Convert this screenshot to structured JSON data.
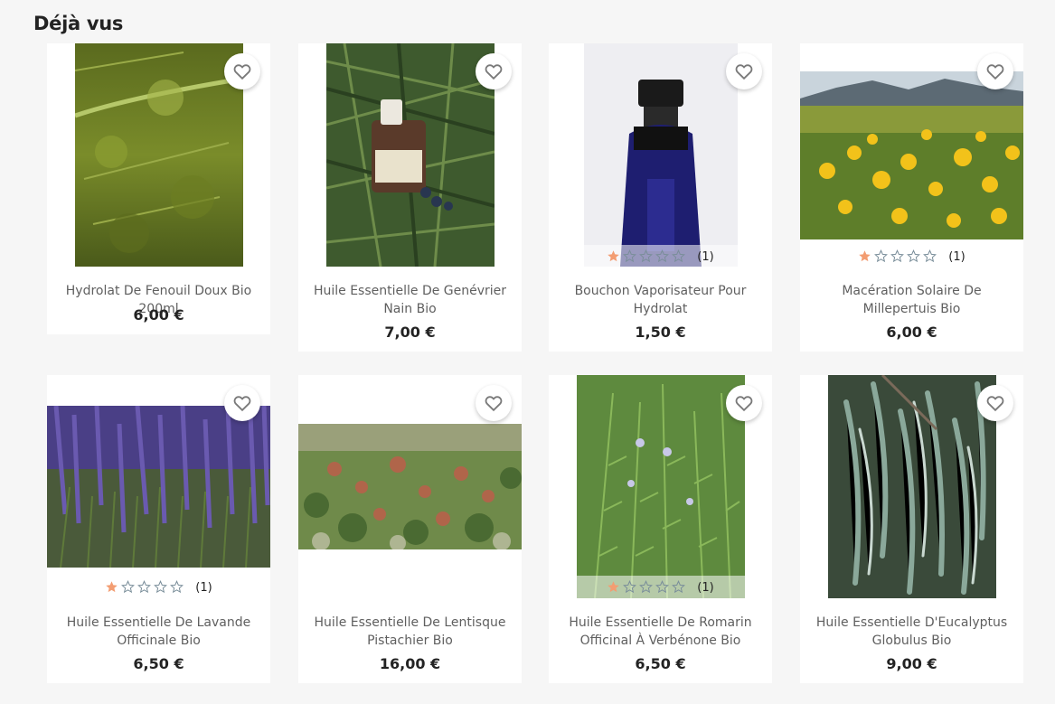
{
  "section": {
    "title": "Déjà vus"
  },
  "colors": {
    "star_filled": "#f39d72",
    "star_empty": "#7a8e9a",
    "background": "#f6f6f6"
  },
  "products": [
    {
      "name": "Hydrolat De Fenouil Doux Bio 200ml",
      "price": "6,00 €",
      "rating": null,
      "image": "fennel-plant-photo"
    },
    {
      "name": "Huile Essentielle De Genévrier Nain Bio",
      "price": "7,00 €",
      "rating": null,
      "image": "juniper-bottle-photo"
    },
    {
      "name": "Bouchon Vaporisateur Pour Hydrolat",
      "price": "1,50 €",
      "rating": {
        "stars": 1,
        "max": 5,
        "count": "(1)"
      },
      "image": "spray-bottle-photo"
    },
    {
      "name": "Macération Solaire De Millepertuis Bio",
      "price": "6,00 €",
      "rating": {
        "stars": 1,
        "max": 5,
        "count": "(1)"
      },
      "image": "st-johns-wort-field-photo"
    },
    {
      "name": "Huile Essentielle De Lavande Officinale Bio",
      "price": "6,50 €",
      "rating": {
        "stars": 1,
        "max": 5,
        "count": "(1)"
      },
      "image": "lavender-field-photo"
    },
    {
      "name": "Huile Essentielle De Lentisque Pistachier Bio",
      "price": "16,00 €",
      "rating": null,
      "image": "mastic-shrub-photo"
    },
    {
      "name": "Huile Essentielle De Romarin Officinal À Verbénone Bio",
      "price": "6,50 €",
      "rating": {
        "stars": 1,
        "max": 5,
        "count": "(1)"
      },
      "image": "rosemary-plant-photo"
    },
    {
      "name": "Huile Essentielle D'Eucalyptus Globulus Bio",
      "price": "9,00 €",
      "rating": null,
      "image": "eucalyptus-leaves-photo"
    }
  ]
}
